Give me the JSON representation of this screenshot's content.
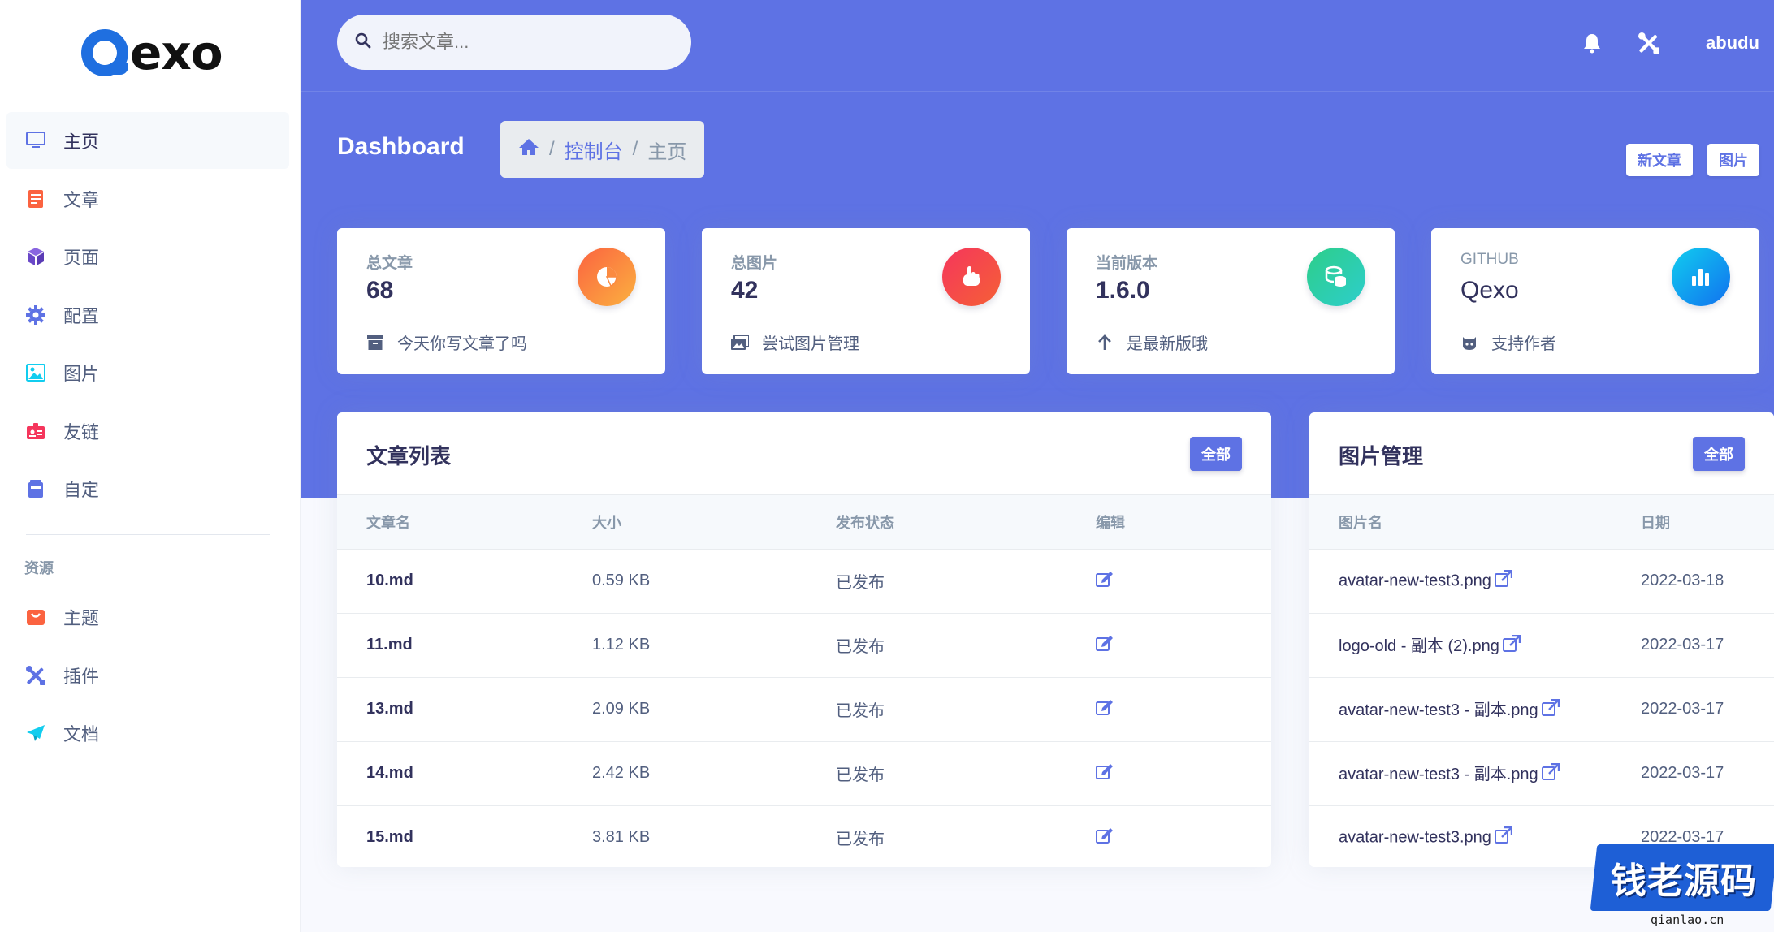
{
  "app": {
    "logo_text": "exo",
    "user": "abudu"
  },
  "search": {
    "placeholder": "搜索文章..."
  },
  "sidebar": {
    "items": [
      {
        "label": "主页",
        "icon": "monitor-icon",
        "active": true
      },
      {
        "label": "文章",
        "icon": "document-icon"
      },
      {
        "label": "页面",
        "icon": "cube-icon"
      },
      {
        "label": "配置",
        "icon": "gear-icon"
      },
      {
        "label": "图片",
        "icon": "image-icon"
      },
      {
        "label": "友链",
        "icon": "badge-icon"
      },
      {
        "label": "自定",
        "icon": "archive-icon"
      }
    ],
    "section_heading": "资源",
    "resources": [
      {
        "label": "主题",
        "icon": "shop-icon"
      },
      {
        "label": "插件",
        "icon": "tools-icon"
      },
      {
        "label": "文档",
        "icon": "paper-plane-icon"
      }
    ]
  },
  "header": {
    "title": "Dashboard",
    "breadcrumb": {
      "level1": "控制台",
      "current": "主页"
    },
    "new_post_button": "新文章",
    "images_button": "图片"
  },
  "stats": [
    {
      "label": "总文章",
      "value": "68",
      "footer": "今天你写文章了吗",
      "icon": "pie-chart-icon",
      "color": "#fb6340"
    },
    {
      "label": "总图片",
      "value": "42",
      "footer": "尝试图片管理",
      "icon": "hand-pointer-icon",
      "color": "#f5365c"
    },
    {
      "label": "当前版本",
      "value": "1.6.0",
      "footer": "是最新版哦",
      "icon": "coins-icon",
      "color": "#2dce89"
    },
    {
      "label": "GITHUB",
      "value": "Qexo",
      "footer": "支持作者",
      "icon": "bar-chart-icon",
      "color": "#11cdef"
    }
  ],
  "posts": {
    "title": "文章列表",
    "all_button": "全部",
    "columns": [
      "文章名",
      "大小",
      "发布状态",
      "编辑"
    ],
    "rows": [
      {
        "name": "10.md",
        "size": "0.59 KB",
        "status": "已发布"
      },
      {
        "name": "11.md",
        "size": "1.12 KB",
        "status": "已发布"
      },
      {
        "name": "13.md",
        "size": "2.09 KB",
        "status": "已发布"
      },
      {
        "name": "14.md",
        "size": "2.42 KB",
        "status": "已发布"
      },
      {
        "name": "15.md",
        "size": "3.81 KB",
        "status": "已发布"
      }
    ]
  },
  "images": {
    "title": "图片管理",
    "all_button": "全部",
    "columns": [
      "图片名",
      "日期"
    ],
    "rows": [
      {
        "name": "avatar-new-test3.png",
        "date": "2022-03-18"
      },
      {
        "name": "logo-old - 副本 (2).png",
        "date": "2022-03-17"
      },
      {
        "name": "avatar-new-test3 - 副本.png",
        "date": "2022-03-17"
      },
      {
        "name": "avatar-new-test3 - 副本.png",
        "date": "2022-03-17"
      },
      {
        "name": "avatar-new-test3.png",
        "date": "2022-03-17"
      }
    ]
  },
  "watermark": {
    "text": "钱老源码",
    "url": "qianlao.cn"
  },
  "colors": {
    "primary": "#5e72e4",
    "orange": "#fb6340",
    "red": "#f5365c",
    "green": "#2dce89",
    "cyan": "#11cdef"
  }
}
